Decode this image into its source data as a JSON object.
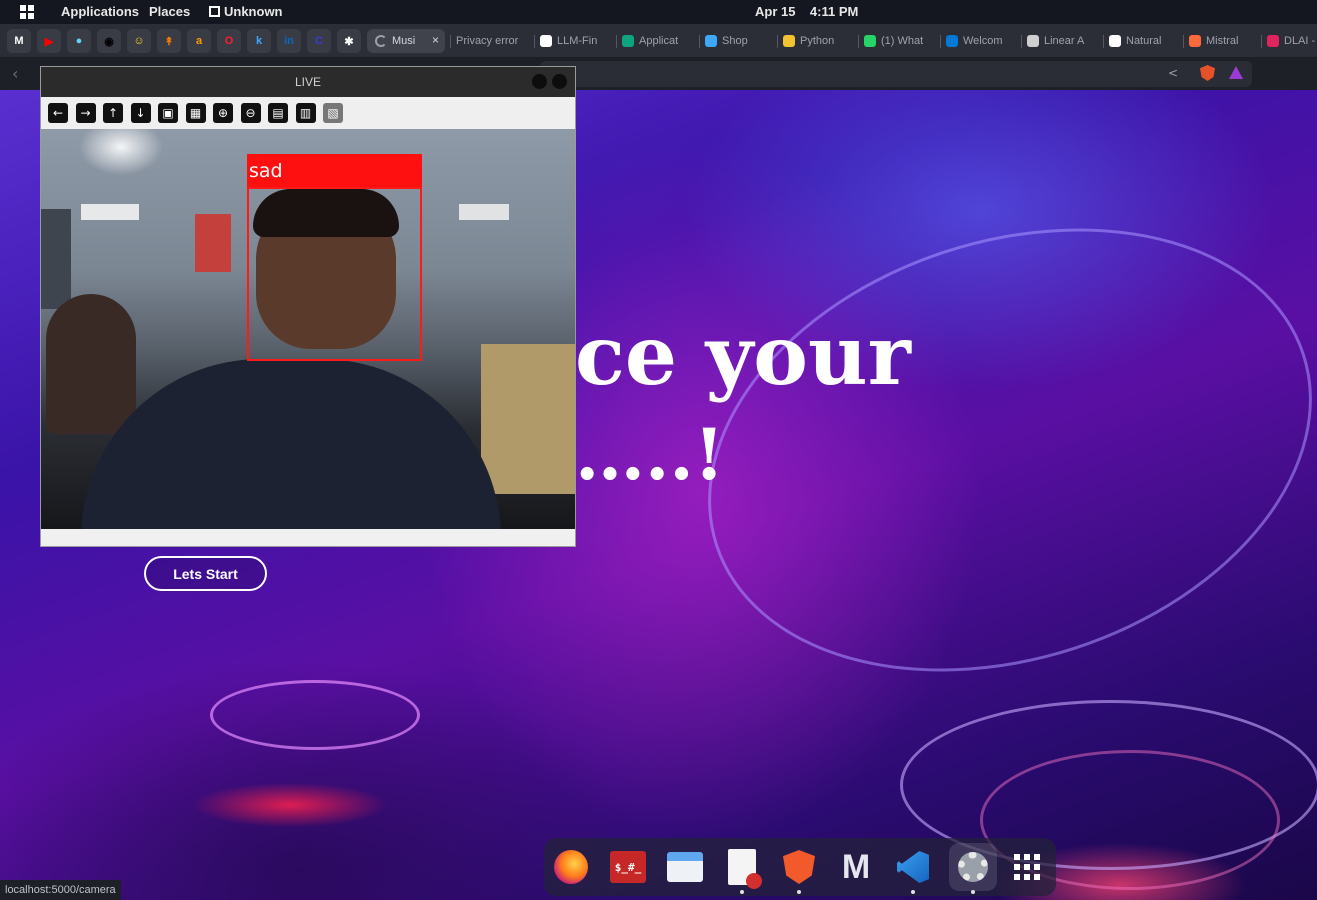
{
  "topbar": {
    "applications": "Applications",
    "places": "Places",
    "window_title": "Unknown",
    "date": "Apr 15",
    "time": "4:11 PM"
  },
  "tabs": {
    "pinned_icons": [
      "gmail-icon",
      "youtube-icon",
      "app-icon",
      "github-icon",
      "app-icon",
      "app-icon",
      "amazon-icon",
      "opera-icon",
      "k-icon",
      "linkedin-icon",
      "c-icon",
      "slack-icon"
    ],
    "pinned_letters": [
      "M",
      "▶",
      "●",
      "◉",
      "☺",
      "↟",
      "a",
      "O",
      "k",
      "in",
      "C",
      "✱"
    ],
    "pinned_colors": [
      "#ffffff",
      "#ff0000",
      "#5fd3f3",
      "#000000",
      "#ffd21e",
      "#ff7a00",
      "#ff9900",
      "#ff1b2d",
      "#3ea8ff",
      "#0a66c2",
      "#3b3bd9",
      "#ffffff"
    ],
    "open": [
      {
        "label": "Musi",
        "color": "#9aa0aa"
      },
      {
        "label": "Privacy error",
        "color": ""
      },
      {
        "label": "LLM-Fin",
        "color": "#ffffff"
      },
      {
        "label": "Applicat",
        "color": "#10a37f"
      },
      {
        "label": "Shop",
        "color": "#3ea8ff"
      },
      {
        "label": "Python",
        "color": "#f2c230"
      },
      {
        "label": "(1) What",
        "color": "#25d366"
      },
      {
        "label": "Welcom",
        "color": "#0078d4"
      },
      {
        "label": "Linear A",
        "color": "#cfcfcf"
      },
      {
        "label": "Natural",
        "color": "#ffffff"
      },
      {
        "label": "Mistral",
        "color": "#ff6a3d"
      },
      {
        "label": "DLAI -",
        "color": "#e0245e"
      }
    ],
    "close_glyph": "×"
  },
  "navbar": {
    "back_glyph": "‹",
    "share_glyph": "<"
  },
  "page": {
    "hero_line1": "ce your",
    "hero_line2": "…..!",
    "start_button": "Lets Start"
  },
  "live_window": {
    "title": "LIVE",
    "toolbar_icons": [
      "arrow-left-icon",
      "arrow-right-icon",
      "arrow-up-icon",
      "arrow-down-icon",
      "image-icon",
      "image-settings-icon",
      "zoom-in-icon",
      "zoom-out-icon",
      "save-icon",
      "clipboard-icon",
      "properties-icon"
    ],
    "toolbar_glyphs": [
      "←",
      "→",
      "↑",
      "↓",
      "▣",
      "▦",
      "⊕",
      "⊖",
      "▤",
      "▥",
      "▧"
    ],
    "emotion_label": "sad"
  },
  "status_url": "localhost:5000/camera",
  "dock": {
    "apps": [
      "firefox-icon",
      "terminal-icon",
      "files-icon",
      "text-editor-icon",
      "brave-icon",
      "mailspring-icon",
      "vscode-icon",
      "settings-icon",
      "app-grid-icon"
    ]
  }
}
